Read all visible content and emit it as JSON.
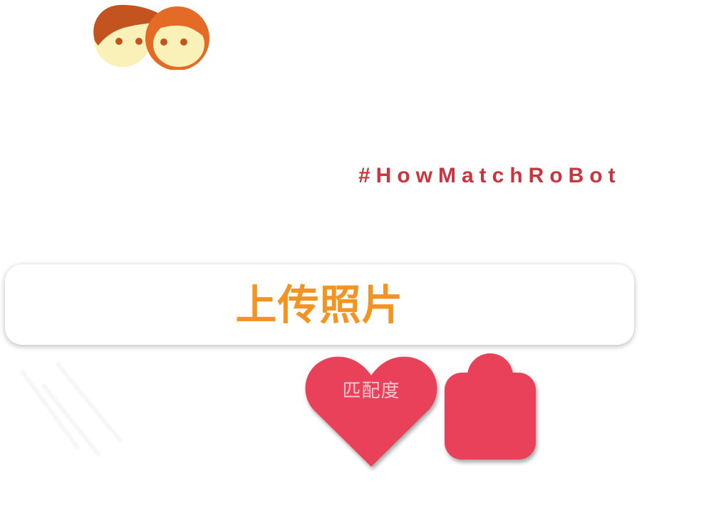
{
  "brand": {
    "hashtag": "#HowMatchRoBot",
    "hashtag_color": "#c8353f",
    "logo_icon": "couple-faces-icon"
  },
  "upload": {
    "label": "上传照片",
    "label_color": "#f39322"
  },
  "actions": {
    "match_button": {
      "label": "匹配度",
      "icon": "heart-icon",
      "color": "#e84159",
      "label_color": "#f6c7cf"
    },
    "shop_button": {
      "icon": "bag-icon",
      "color": "#e84159"
    }
  }
}
